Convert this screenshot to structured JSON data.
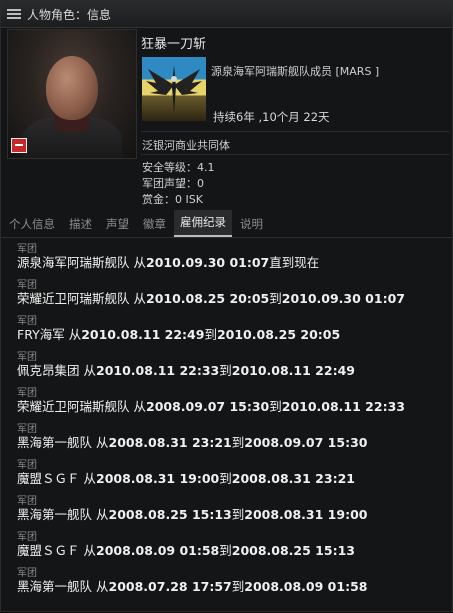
{
  "window": {
    "title": "人物角色：信息"
  },
  "character": {
    "name": "狂暴一刀斩",
    "corp_line": "源泉海军阿瑞斯舰队成员 [MARS ]",
    "tenure": "持续6年 ,10个月 22天",
    "alliance": "泛银河商业共同体",
    "security": "安全等级：4.1",
    "faction_standing": "军团声望：0",
    "bounty": "赏金：0 ISK"
  },
  "tabs": [
    {
      "label": "个人信息"
    },
    {
      "label": "描述"
    },
    {
      "label": "声望"
    },
    {
      "label": "徽章"
    },
    {
      "label": "雇佣纪录",
      "active": true
    },
    {
      "label": "说明"
    }
  ],
  "history_label": "军团",
  "history": [
    {
      "corp": "源泉海军阿瑞斯舰队",
      "from_word": "从",
      "start": "2010.09.30 01:07",
      "to_word": "直到现在",
      "end": ""
    },
    {
      "corp": "荣耀近卫阿瑞斯舰队",
      "from_word": "从",
      "start": "2010.08.25 20:05",
      "to_word": "到",
      "end": "2010.09.30 01:07"
    },
    {
      "corp": "FRY海军",
      "from_word": "从",
      "start": "2010.08.11 22:49",
      "to_word": "到",
      "end": "2010.08.25 20:05"
    },
    {
      "corp": "佩克昂集团",
      "from_word": "从",
      "start": "2010.08.11 22:33",
      "to_word": "到",
      "end": "2010.08.11 22:49"
    },
    {
      "corp": "荣耀近卫阿瑞斯舰队",
      "from_word": "从",
      "start": "2008.09.07 15:30",
      "to_word": "到",
      "end": "2010.08.11 22:33"
    },
    {
      "corp": "黑海第一舰队",
      "from_word": "从",
      "start": "2008.08.31 23:21",
      "to_word": "到",
      "end": "2008.09.07 15:30"
    },
    {
      "corp": "魔盟ＳＧＦ",
      "from_word": "从",
      "start": "2008.08.31 19:00",
      "to_word": "到",
      "end": "2008.08.31 23:21"
    },
    {
      "corp": "黑海第一舰队",
      "from_word": "从",
      "start": "2008.08.25 15:13",
      "to_word": "到",
      "end": "2008.08.31 19:00"
    },
    {
      "corp": "魔盟ＳＧＦ",
      "from_word": "从",
      "start": "2008.08.09 01:58",
      "to_word": "到",
      "end": "2008.08.25 15:13"
    },
    {
      "corp": "黑海第一舰队",
      "from_word": "从",
      "start": "2008.07.28 17:57",
      "to_word": "到",
      "end": "2008.08.09 01:58"
    }
  ]
}
